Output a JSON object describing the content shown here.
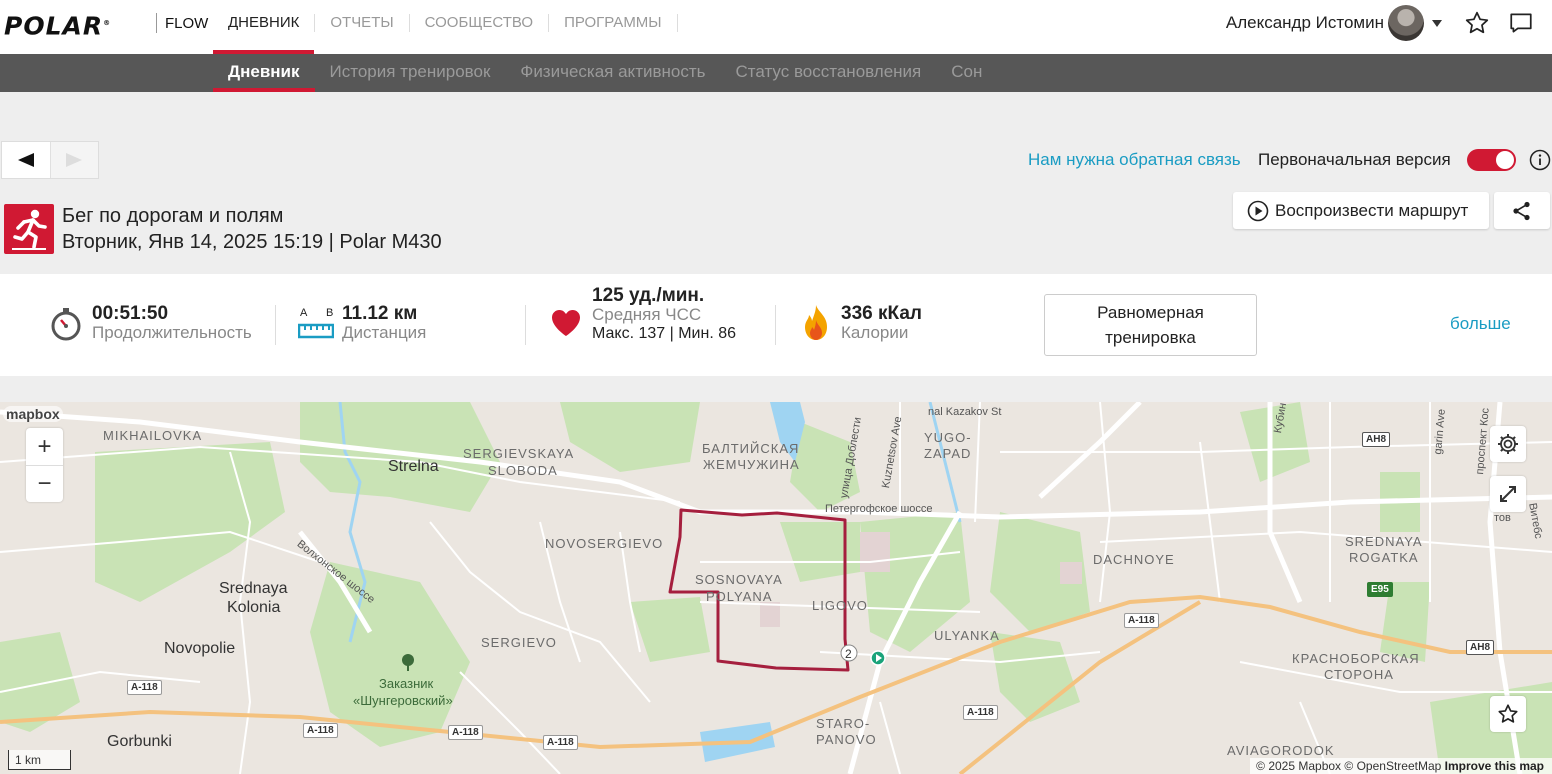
{
  "header": {
    "logo": "POLAR",
    "flow": "FLOW",
    "nav": [
      "ДНЕВНИК",
      "ОТЧЕТЫ",
      "СООБЩЕСТВО",
      "ПРОГРАММЫ"
    ],
    "user_name": "Александр Истомин"
  },
  "subnav": [
    "Дневник",
    "История тренировок",
    "Физическая активность",
    "Статус восстановления",
    "Сон"
  ],
  "toolbar": {
    "feedback": "Нам нужна обратная связь",
    "original_version": "Первоначальная версия",
    "toggle_on": true
  },
  "activity": {
    "title": "Бег по дорогам и полям",
    "subtitle": "Вторник, Янв 14, 2025 15:19 | Polar M430",
    "replay_label": "Воспроизвести маршрут"
  },
  "stats": {
    "duration_value": "00:51:50",
    "duration_label": "Продолжительность",
    "distance_value": "11.12 км",
    "distance_label": "Дистанция",
    "distance_a": "A",
    "distance_b": "B",
    "hr_value": "125 уд./мин.",
    "hr_label": "Средняя ЧСС",
    "hr_minmax": "Макс. 137  |  Мин. 86",
    "calories_value": "336 кКал",
    "calories_label": "Калории",
    "zone_label": "Равномерная тренировка",
    "more": "больше"
  },
  "map": {
    "logo": "mapbox",
    "scale": "1 km",
    "attribution_1": "© 2025 Mapbox",
    "attribution_2": "© OpenStreetMap",
    "attribution_3": "Improve this map",
    "labels": {
      "mikhailovka": "MIKHAILOVKA",
      "strelna": "Strelna",
      "sergievskaya": "SERGIEVSKAYA",
      "sloboda": "SLOBODA",
      "baltic1": "БАЛТИЙСКАЯ",
      "baltic2": "ЖЕМЧУЖИНА",
      "yugo": "YUGO-",
      "zapad": "ZAPAD",
      "kazakov": "nal Kazakov St",
      "novosergievo": "NOVOSERGIEVO",
      "sosnovaya": "SOSNOVAYA",
      "polyana": "POLYANA",
      "ligovo": "LIGOVO",
      "dachnoye": "DACHNOYE",
      "srednaya_rogatka_1": "SREDNAYA",
      "srednaya_rogatka_2": "ROGATKA",
      "srednaya_kolonia_1": "Srednaya",
      "srednaya_kolonia_2": "Kolonia",
      "novopolie": "Novopolie",
      "sergievo": "SERGIEVO",
      "ulyanka": "ULYANKA",
      "krasnoborskaya_1": "КРАСНОБОРСКАЯ",
      "krasnoborskaya_2": "СТОРОНА",
      "zakaznik_1": "Заказник",
      "zakaznik_2": "«Шунгеровский»",
      "gorbunki": "Gorbunki",
      "staro": "STARO-",
      "panovo": "PANOVO",
      "aviagorodok": "AVIAGORODOK",
      "petergof": "Петергофское шоссе",
      "volkhonskoe": "Волхонское шоссе",
      "dobrest": "улица Доблести",
      "kuznetsov": "Kuznetsov Ave",
      "kubin": "Кубин",
      "gagarin": "garin Ave",
      "prospekt": "проспект Кос",
      "tov": "тов",
      "vitebsk": "Витебс",
      "shields": [
        "A-118",
        "A-118",
        "A-118",
        "A-118",
        "A-118",
        "A-118",
        "AH8",
        "AH8",
        "E95"
      ],
      "marker": "2"
    }
  }
}
